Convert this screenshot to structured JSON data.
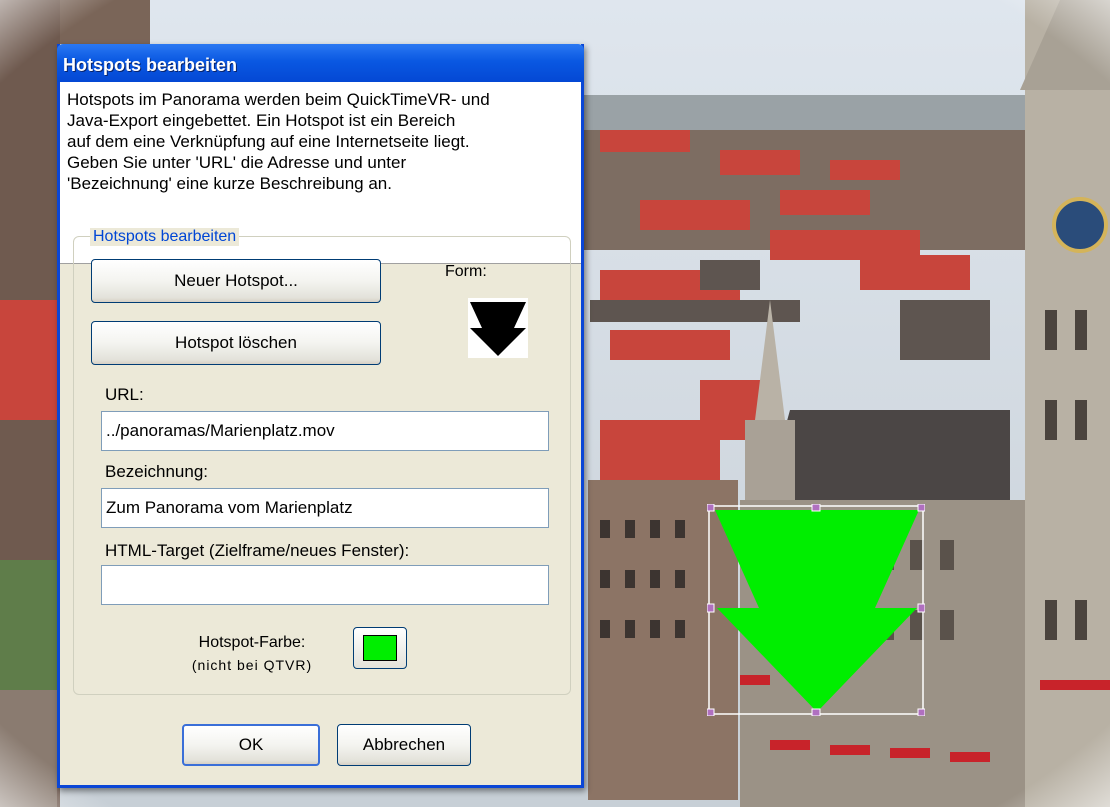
{
  "dialog": {
    "title": "Hotspots bearbeiten",
    "info_lines": [
      "Hotspots im Panorama werden beim QuickTimeVR- und",
      "Java-Export eingebettet. Ein Hotspot ist ein Bereich",
      "auf dem eine Verknüpfung auf eine Internetseite liegt.",
      "Geben Sie unter 'URL' die Adresse und unter",
      "'Bezeichnung' eine kurze Beschreibung an."
    ],
    "group_title": "Hotspots bearbeiten",
    "new_hotspot_label": "Neuer Hotspot...",
    "delete_hotspot_label": "Hotspot löschen",
    "form_label": "Form:",
    "form_icon": "arrow-down-icon",
    "url_label": "URL:",
    "url_value": "../panoramas/Marienplatz.mov",
    "name_label": "Bezeichnung:",
    "name_value": "Zum Panorama vom Marienplatz",
    "target_label": "HTML-Target (Zielframe/neues Fenster):",
    "target_value": "",
    "color_label": "Hotspot-Farbe:",
    "color_note": "(nicht bei QTVR)",
    "hotspot_color": "#00ee00",
    "ok_label": "OK",
    "cancel_label": "Abbrechen"
  },
  "overlay": {
    "shape_icon": "green-arrow-down-hotspot",
    "fill_color": "#00ee00",
    "handle_color": "#b070c0"
  }
}
